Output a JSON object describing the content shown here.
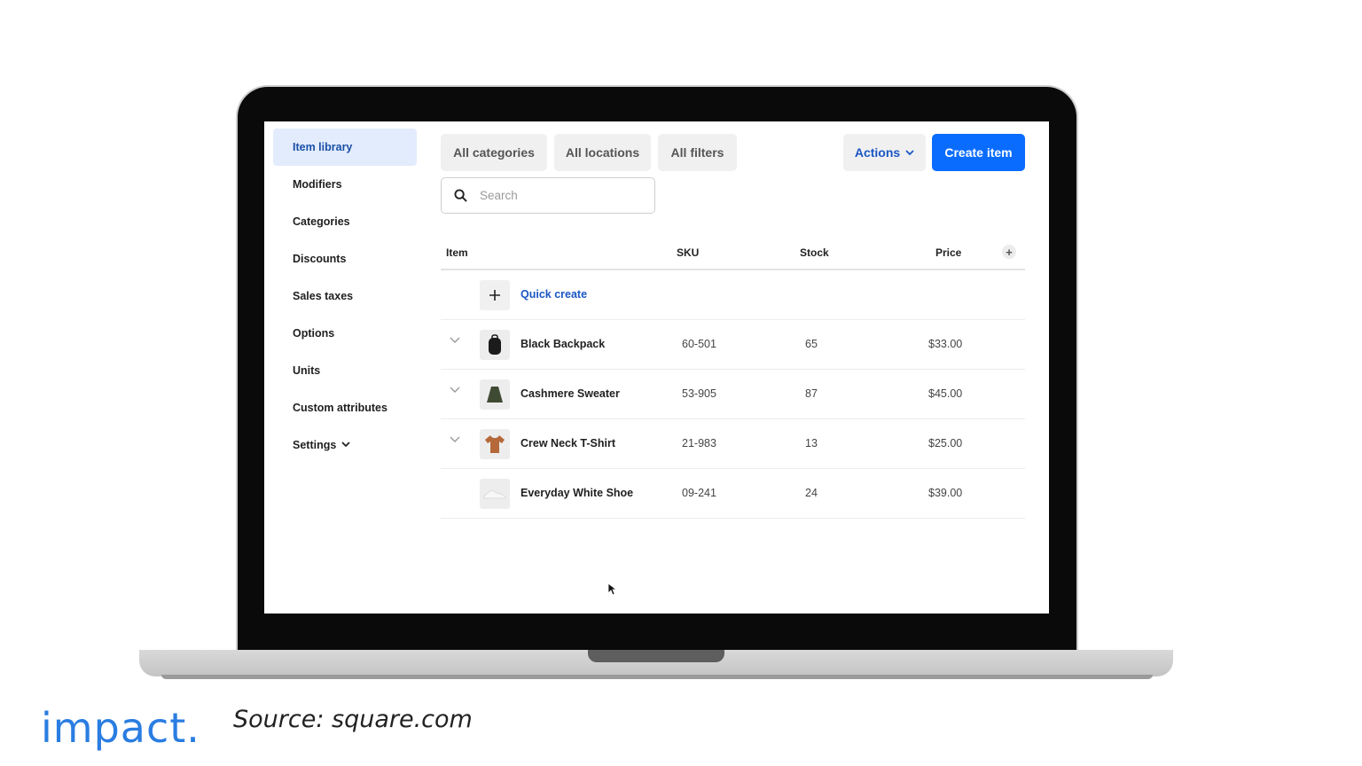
{
  "sidebar": {
    "items": [
      {
        "label": "Item library",
        "active": true
      },
      {
        "label": "Modifiers"
      },
      {
        "label": "Categories"
      },
      {
        "label": "Discounts"
      },
      {
        "label": "Sales taxes"
      },
      {
        "label": "Options"
      },
      {
        "label": "Units"
      },
      {
        "label": "Custom attributes"
      },
      {
        "label": "Settings",
        "has_chevron": true
      }
    ]
  },
  "toolbar": {
    "filters": [
      "All categories",
      "All locations",
      "All filters"
    ],
    "actions_label": "Actions",
    "create_label": "Create item"
  },
  "search": {
    "placeholder": "Search"
  },
  "table": {
    "headers": {
      "item": "Item",
      "sku": "SKU",
      "stock": "Stock",
      "price": "Price"
    },
    "quick_create_label": "Quick create",
    "rows": [
      {
        "name": "Black Backpack",
        "sku": "60-501",
        "stock": "65",
        "price": "$33.00",
        "expandable": true,
        "thumb_icon": "backpack-icon"
      },
      {
        "name": "Cashmere Sweater",
        "sku": "53-905",
        "stock": "87",
        "price": "$45.00",
        "expandable": true,
        "thumb_icon": "sweater-icon"
      },
      {
        "name": "Crew Neck T-Shirt",
        "sku": "21-983",
        "stock": "13",
        "price": "$25.00",
        "expandable": true,
        "thumb_icon": "tshirt-icon"
      },
      {
        "name": "Everyday White Shoe",
        "sku": "09-241",
        "stock": "24",
        "price": "$39.00",
        "expandable": false,
        "thumb_icon": "shoe-icon"
      }
    ]
  },
  "footer": {
    "brand": "impact.",
    "source": "Source: square.com"
  },
  "colors": {
    "accent": "#0a6cff",
    "brand": "#2a7de1",
    "active_nav_bg": "#e2ecfd"
  }
}
